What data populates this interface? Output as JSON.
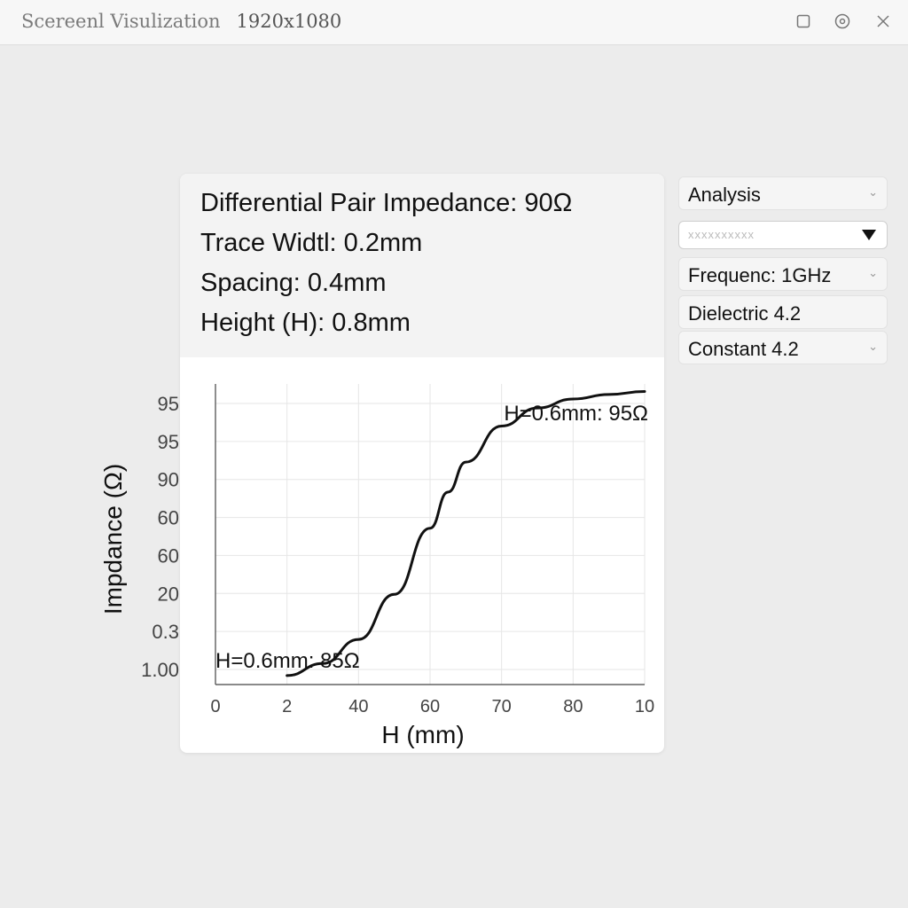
{
  "window": {
    "title": "Scereenl Visulization",
    "resolution": "1920x1080",
    "icons": [
      "maximize-icon",
      "settings-icon",
      "close-icon"
    ]
  },
  "params": {
    "impedance": "Differential Pair Impedance: 90Ω",
    "trace_width": "Trace Widtl: 0.2mm",
    "spacing": "Spacing: 0.4mm",
    "height": "Height (H): 0.8mm"
  },
  "panel": {
    "analysis": "Analysis",
    "select_value": "xxxxxxxxxx",
    "frequency": "Frequenc: 1GHz",
    "dielectric": "Dielectric 4.2",
    "constant": "Constant 4.2"
  },
  "chart_data": {
    "type": "line",
    "xlabel": "H (mm)",
    "ylabel": "Impdance (Ω)",
    "x_ticks": [
      "0",
      "2",
      "40",
      "60",
      "70",
      "80",
      "10"
    ],
    "y_ticks": [
      "95",
      "95",
      "90",
      "60",
      "60",
      "20",
      "0.3",
      "1.00"
    ],
    "series": [
      {
        "x_index": [
          1,
          1.5,
          2,
          2.5,
          3,
          3.25,
          3.5,
          4,
          4.5,
          5,
          5.5,
          6
        ],
        "values": [
          0.03,
          0.07,
          0.15,
          0.3,
          0.52,
          0.64,
          0.74,
          0.86,
          0.92,
          0.95,
          0.965,
          0.975
        ]
      }
    ],
    "annotations": [
      {
        "text": "H=0.6mm: 95Ω",
        "position": "top-right"
      },
      {
        "text": "H=0.6mm: 85Ω",
        "position": "bottom-left"
      }
    ],
    "grid": true
  }
}
